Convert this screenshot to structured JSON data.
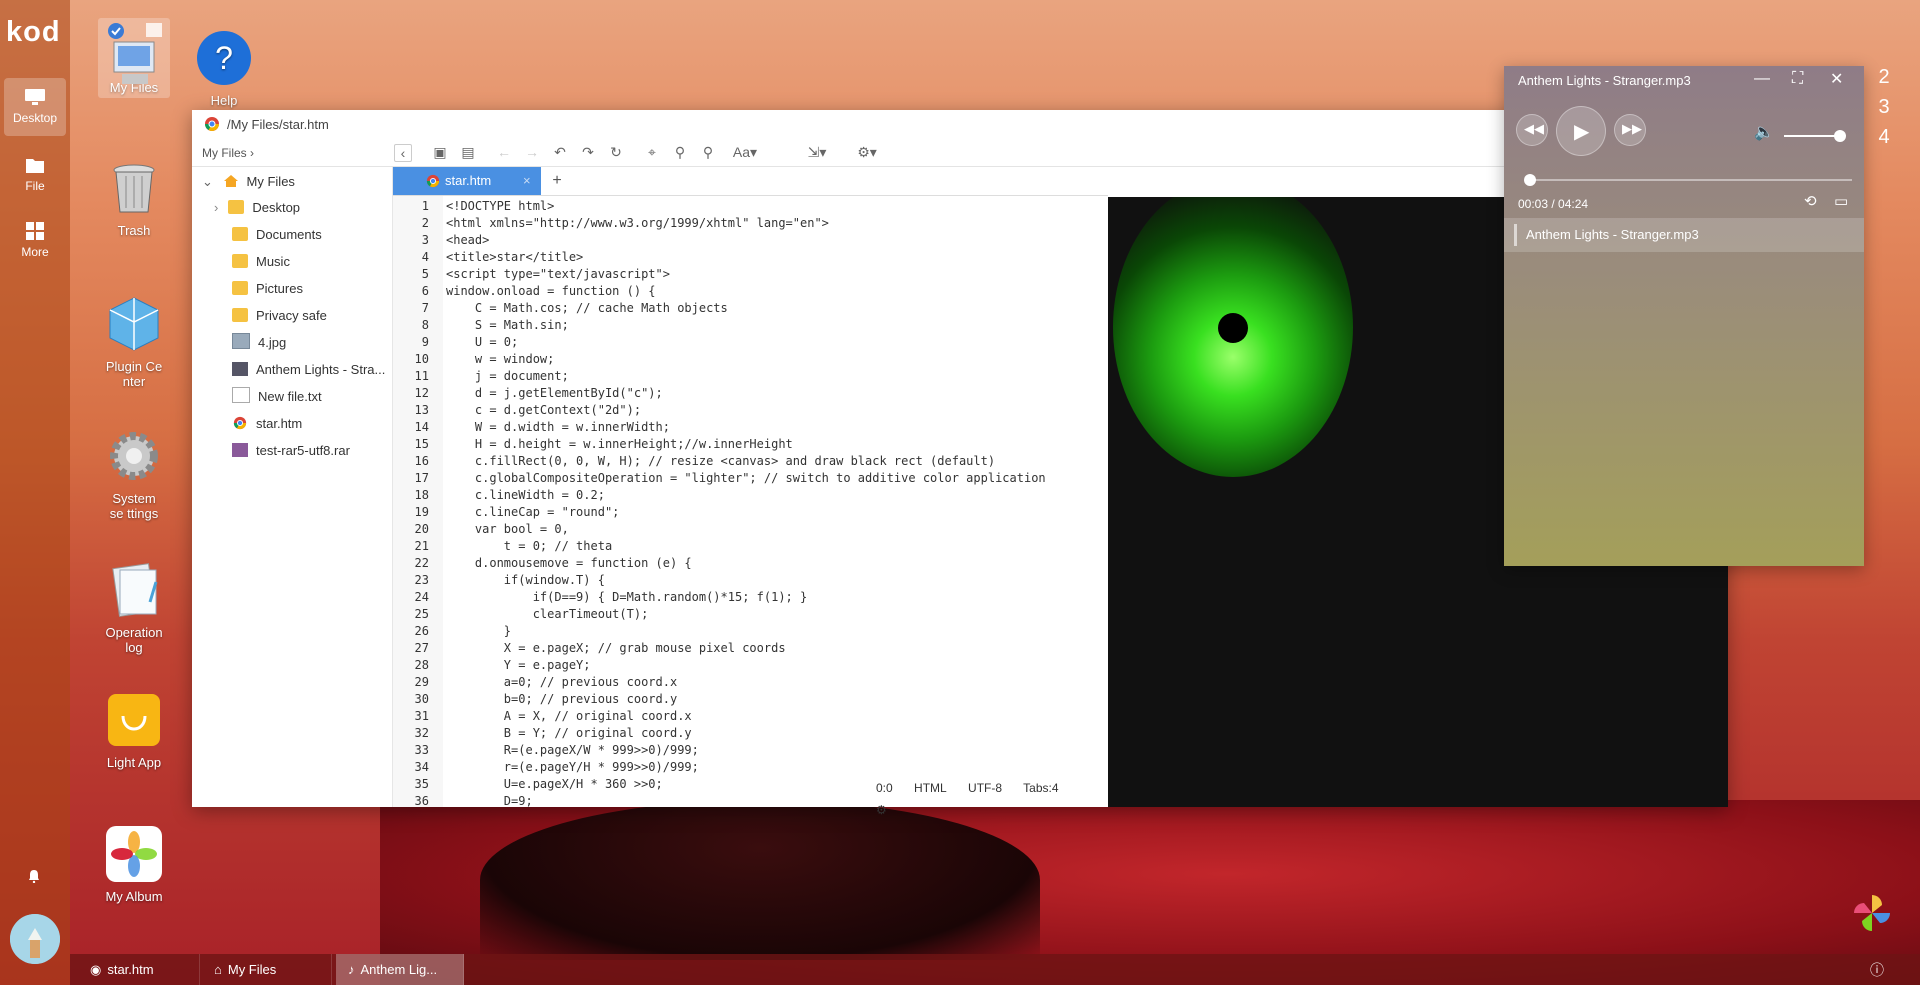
{
  "sidebar": {
    "logo": "kod",
    "items": [
      {
        "label": "Desktop",
        "icon": "desktop-icon"
      },
      {
        "label": "File",
        "icon": "file-icon"
      },
      {
        "label": "More",
        "icon": "grid-icon"
      }
    ]
  },
  "desktop": {
    "icons": [
      {
        "label": "My Files",
        "icon": "computer-icon"
      },
      {
        "label": "Help",
        "icon": "help-icon"
      },
      {
        "label": "Trash",
        "icon": "trash-icon"
      },
      {
        "label": "Plugin Ce nter",
        "icon": "plugin-icon"
      },
      {
        "label": "System se ttings",
        "icon": "gear-icon"
      },
      {
        "label": "Operation log",
        "icon": "log-icon"
      },
      {
        "label": "Light App",
        "icon": "shopping-bag-icon"
      },
      {
        "label": "My Album",
        "icon": "photos-icon"
      }
    ]
  },
  "editor_window": {
    "title": "/My Files/star.htm",
    "breadcrumb": "My Files ›",
    "tree": {
      "root": "My Files",
      "items": [
        "Desktop",
        "Documents",
        "Music",
        "Pictures",
        "Privacy safe",
        "4.jpg",
        "Anthem Lights - Stra...",
        "New file.txt",
        "star.htm",
        "test-rar5-utf8.rar"
      ]
    },
    "tab": "star.htm",
    "tab_add": "+",
    "code_lines": [
      "<!DOCTYPE html>",
      "<html xmlns=\"http://www.w3.org/1999/xhtml\" lang=\"en\">",
      "<head>",
      "<title>star</title>",
      "<script type=\"text/javascript\">",
      "window.onload = function () {",
      "    C = Math.cos; // cache Math objects",
      "    S = Math.sin;",
      "    U = 0;",
      "    w = window;",
      "    j = document;",
      "    d = j.getElementById(\"c\");",
      "    c = d.getContext(\"2d\");",
      "    W = d.width = w.innerWidth;",
      "    H = d.height = w.innerHeight;//w.innerHeight",
      "    c.fillRect(0, 0, W, H); // resize <canvas> and draw black rect (default)",
      "    c.globalCompositeOperation = \"lighter\"; // switch to additive color application",
      "    c.lineWidth = 0.2;",
      "    c.lineCap = \"round\";",
      "    var bool = 0,",
      "        t = 0; // theta",
      "    d.onmousemove = function (e) {",
      "        if(window.T) {",
      "            if(D==9) { D=Math.random()*15; f(1); }",
      "            clearTimeout(T);",
      "        }",
      "        X = e.pageX; // grab mouse pixel coords",
      "        Y = e.pageY;",
      "        a=0; // previous coord.x",
      "        b=0; // previous coord.y",
      "        A = X, // original coord.x",
      "        B = Y; // original coord.y",
      "        R=(e.pageX/W * 999>>0)/999;",
      "        r=(e.pageY/H * 999>>0)/999;",
      "        U=e.pageX/H * 360 >>0;",
      "        D=9;"
    ],
    "status": {
      "pos": "0:0",
      "mode": "HTML",
      "encoding": "UTF-8",
      "tabs": "Tabs:4"
    }
  },
  "player": {
    "title": "Anthem Lights - Stranger.mp3",
    "time": "00:03 / 04:24",
    "progress": 0.011,
    "volume": 1.0,
    "playlist": [
      "Anthem Lights - Stranger.mp3"
    ]
  },
  "taskbar": {
    "items": [
      "star.htm",
      "My Files",
      "Anthem Lig..."
    ]
  },
  "clock": {
    "digits": [
      "2",
      "3",
      "4"
    ]
  }
}
